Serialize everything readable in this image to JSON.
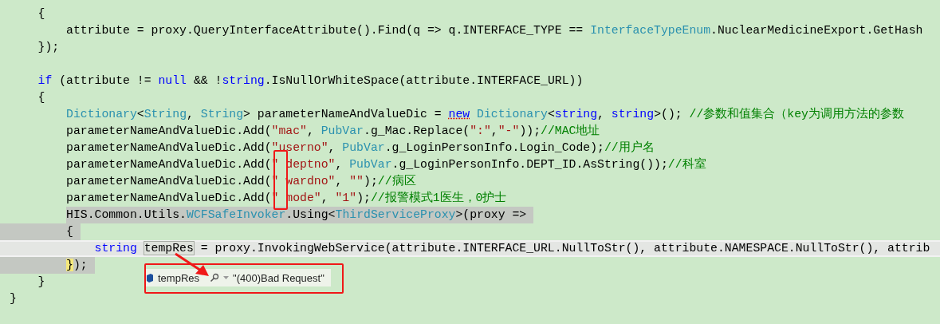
{
  "editor": {
    "lines": [
      {
        "kind": "code",
        "selected": false,
        "current": false,
        "tokens": [
          {
            "kind": "plain",
            "text": "    {"
          }
        ]
      },
      {
        "kind": "code",
        "selected": false,
        "current": false,
        "tokens": [
          {
            "kind": "plain",
            "text": "        attribute = proxy.QueryInterfaceAttribute().Find(q => q.INTERFACE_TYPE == "
          },
          {
            "kind": "type",
            "text": "InterfaceTypeEnum"
          },
          {
            "kind": "plain",
            "text": ".NuclearMedicineExport.GetHash"
          }
        ]
      },
      {
        "kind": "code",
        "selected": false,
        "current": false,
        "tokens": [
          {
            "kind": "plain",
            "text": "    });"
          }
        ]
      },
      {
        "kind": "blank"
      },
      {
        "kind": "code",
        "selected": false,
        "current": false,
        "tokens": [
          {
            "kind": "keyword",
            "text": "    if"
          },
          {
            "kind": "plain",
            "text": " (attribute != "
          },
          {
            "kind": "keyword",
            "text": "null"
          },
          {
            "kind": "plain",
            "text": " && !"
          },
          {
            "kind": "keyword",
            "text": "string"
          },
          {
            "kind": "plain",
            "text": ".IsNullOrWhiteSpace(attribute.INTERFACE_URL))"
          }
        ]
      },
      {
        "kind": "code",
        "selected": false,
        "current": false,
        "tokens": [
          {
            "kind": "plain",
            "text": "    {"
          }
        ]
      },
      {
        "kind": "code",
        "selected": false,
        "current": false,
        "tokens": [
          {
            "kind": "type",
            "text": "        Dictionary"
          },
          {
            "kind": "plain",
            "text": "<"
          },
          {
            "kind": "type",
            "text": "String"
          },
          {
            "kind": "plain",
            "text": ", "
          },
          {
            "kind": "type",
            "text": "String"
          },
          {
            "kind": "plain",
            "text": "> parameterNameAndValueDic = "
          },
          {
            "kind": "flagged-keyword",
            "text": "new"
          },
          {
            "kind": "type",
            "text": " Dictionary"
          },
          {
            "kind": "plain",
            "text": "<"
          },
          {
            "kind": "keyword",
            "text": "string"
          },
          {
            "kind": "plain",
            "text": ", "
          },
          {
            "kind": "keyword",
            "text": "string"
          },
          {
            "kind": "plain",
            "text": ">(); "
          },
          {
            "kind": "comment",
            "text": "//参数和值集合（key为调用方法的参数"
          }
        ]
      },
      {
        "kind": "code",
        "selected": false,
        "current": false,
        "tokens": [
          {
            "kind": "plain",
            "text": "        parameterNameAndValueDic.Add("
          },
          {
            "kind": "string",
            "text": "\"mac\""
          },
          {
            "kind": "plain",
            "text": ", "
          },
          {
            "kind": "type",
            "text": "PubVar"
          },
          {
            "kind": "plain",
            "text": ".g_Mac.Replace("
          },
          {
            "kind": "string",
            "text": "\":\""
          },
          {
            "kind": "plain",
            "text": ","
          },
          {
            "kind": "string",
            "text": "\"-\""
          },
          {
            "kind": "plain",
            "text": "));"
          },
          {
            "kind": "comment",
            "text": "//MAC地址"
          }
        ]
      },
      {
        "kind": "code",
        "selected": false,
        "current": false,
        "tokens": [
          {
            "kind": "plain",
            "text": "        parameterNameAndValueDic.Add("
          },
          {
            "kind": "string",
            "text": "\"userno\""
          },
          {
            "kind": "plain",
            "text": ", "
          },
          {
            "kind": "type",
            "text": "PubVar"
          },
          {
            "kind": "plain",
            "text": ".g_LoginPersonInfo.Login_Code);"
          },
          {
            "kind": "comment",
            "text": "//用户名"
          }
        ]
      },
      {
        "kind": "code",
        "selected": false,
        "current": false,
        "tokens": [
          {
            "kind": "plain",
            "text": "        parameterNameAndValueDic.Add("
          },
          {
            "kind": "string",
            "text": "\" deptno\""
          },
          {
            "kind": "plain",
            "text": ", "
          },
          {
            "kind": "type",
            "text": "PubVar"
          },
          {
            "kind": "plain",
            "text": ".g_LoginPersonInfo.DEPT_ID.AsString());"
          },
          {
            "kind": "comment",
            "text": "//科室"
          }
        ]
      },
      {
        "kind": "code",
        "selected": false,
        "current": false,
        "tokens": [
          {
            "kind": "plain",
            "text": "        parameterNameAndValueDic.Add("
          },
          {
            "kind": "string",
            "text": "\" wardno\""
          },
          {
            "kind": "plain",
            "text": ", "
          },
          {
            "kind": "string",
            "text": "\"\""
          },
          {
            "kind": "plain",
            "text": ");"
          },
          {
            "kind": "comment",
            "text": "//病区"
          }
        ]
      },
      {
        "kind": "code",
        "selected": false,
        "current": false,
        "tokens": [
          {
            "kind": "plain",
            "text": "        parameterNameAndValueDic.Add("
          },
          {
            "kind": "string",
            "text": "\" mode\""
          },
          {
            "kind": "plain",
            "text": ", "
          },
          {
            "kind": "string",
            "text": "\"1\""
          },
          {
            "kind": "plain",
            "text": ");"
          },
          {
            "kind": "comment",
            "text": "//报警模式1医生，0护士"
          }
        ]
      },
      {
        "kind": "code",
        "selected": true,
        "current": false,
        "tokens": [
          {
            "kind": "plain",
            "text": "        HIS.Common.Utils."
          },
          {
            "kind": "type",
            "text": "WCFSafeInvoker"
          },
          {
            "kind": "plain",
            "text": ".Using<"
          },
          {
            "kind": "type",
            "text": "ThirdServiceProxy"
          },
          {
            "kind": "plain",
            "text": ">(proxy =>"
          }
        ]
      },
      {
        "kind": "code",
        "selected": true,
        "current": false,
        "tokens": [
          {
            "kind": "plain",
            "text": "        {"
          }
        ]
      },
      {
        "kind": "code",
        "selected": false,
        "current": true,
        "tokens": [
          {
            "kind": "keyword",
            "text": "            string "
          },
          {
            "kind": "reference",
            "text": "tempRes"
          },
          {
            "kind": "plain",
            "text": " = proxy.InvokingWebService(attribute.INTERFACE_URL.NullToStr(), attribute.NAMESPACE.NullToStr(), attrib"
          }
        ]
      },
      {
        "kind": "code",
        "selected": true,
        "current": false,
        "tokens": [
          {
            "kind": "brace",
            "text": "        }"
          },
          {
            "kind": "plain",
            "text": ");"
          }
        ]
      },
      {
        "kind": "code",
        "selected": false,
        "current": false,
        "tokens": [
          {
            "kind": "plain",
            "text": "    }"
          }
        ]
      },
      {
        "kind": "code",
        "selected": false,
        "current": false,
        "tokens": [
          {
            "kind": "plain",
            "text": "}"
          }
        ]
      }
    ]
  },
  "datatip": {
    "name": "tempRes",
    "value": "\"(400)Bad Request\""
  }
}
